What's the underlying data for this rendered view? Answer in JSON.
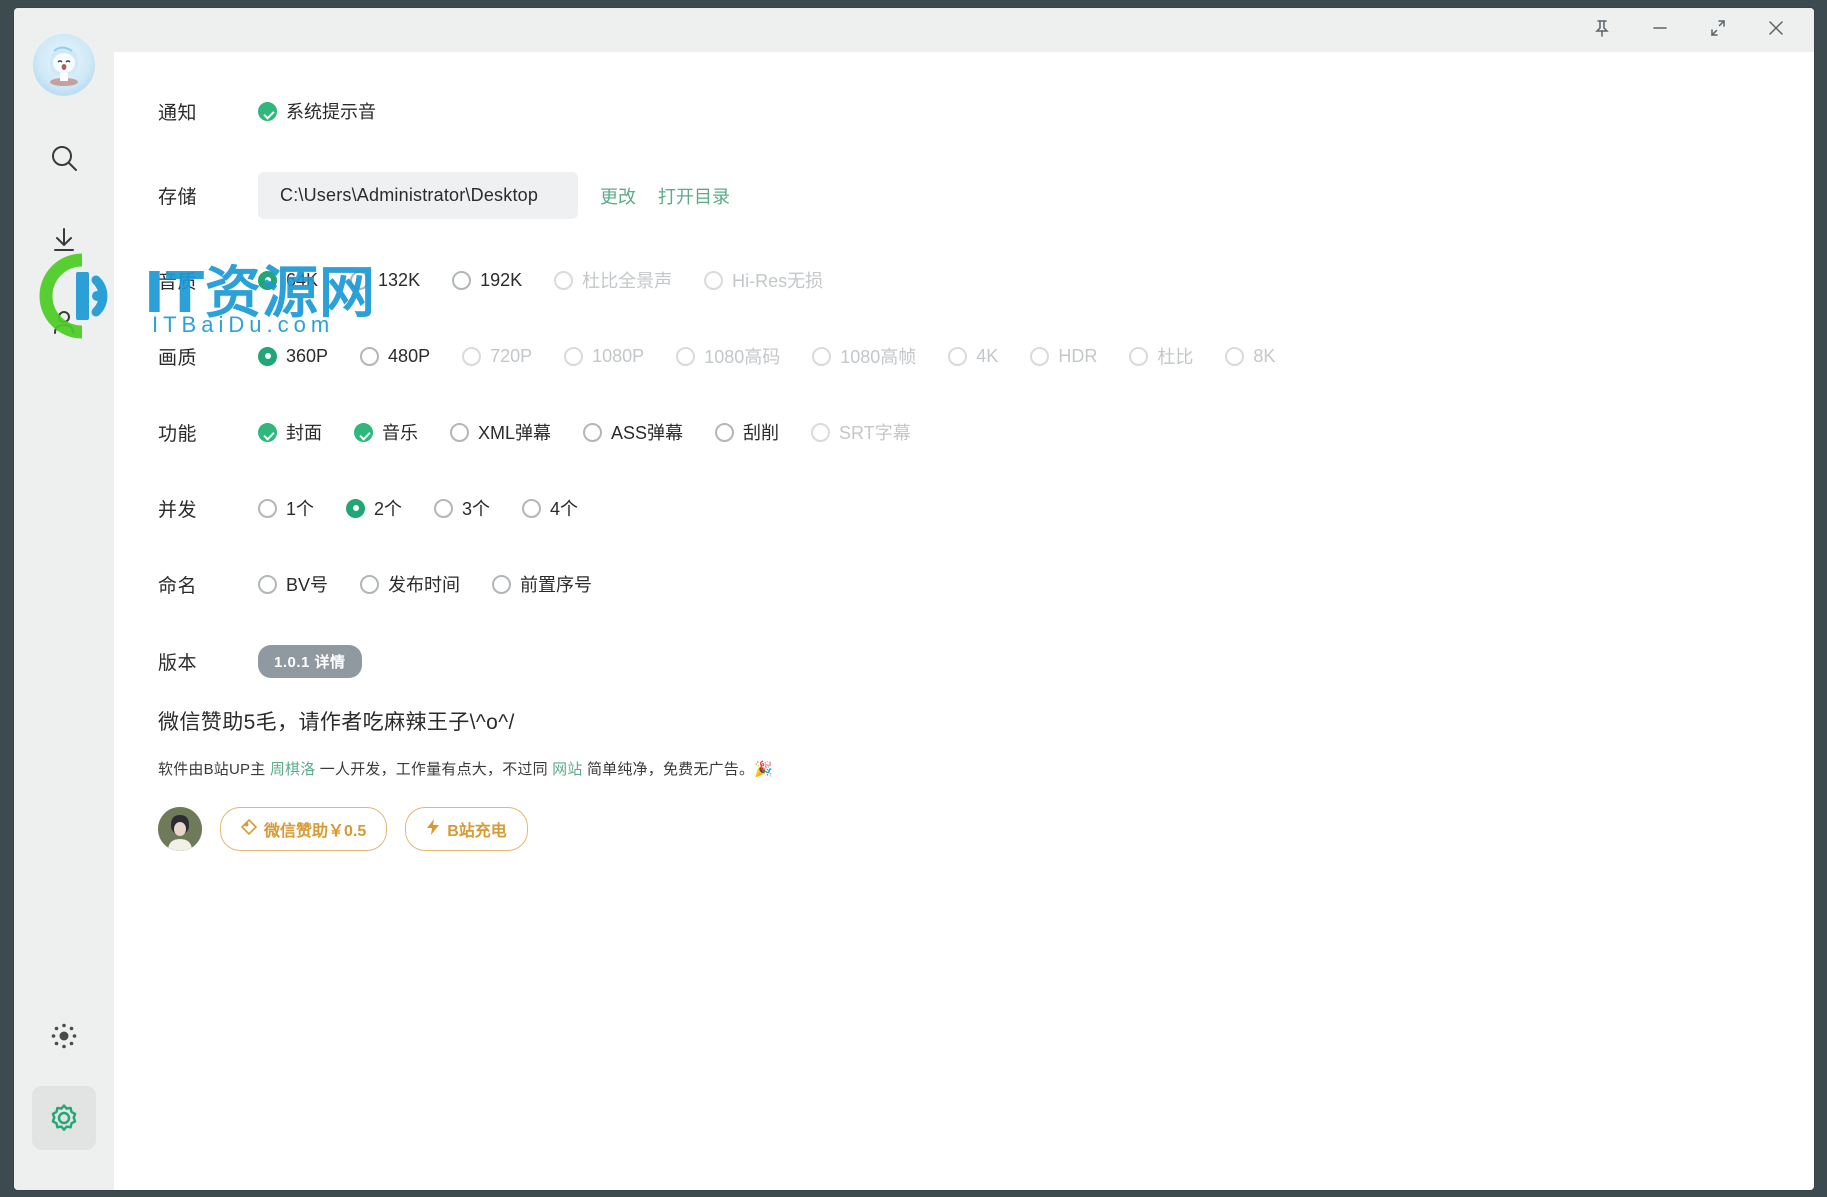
{
  "window": {
    "controls": [
      {
        "name": "pin",
        "label": "Pin"
      },
      {
        "name": "minimize",
        "label": "Minimize"
      },
      {
        "name": "maximize",
        "label": "Maximize"
      },
      {
        "name": "close",
        "label": "Close"
      }
    ]
  },
  "sidebar": {
    "mascot": "mascot-avatar",
    "items": [
      {
        "icon": "search-icon",
        "label": "搜索",
        "active": false
      },
      {
        "icon": "download-icon",
        "label": "下载",
        "active": false
      },
      {
        "icon": "user-icon",
        "label": "用户",
        "active": false
      }
    ],
    "bottom": [
      {
        "icon": "sun-icon",
        "label": "主题",
        "active": false
      },
      {
        "icon": "gear-icon",
        "label": "设置",
        "active": true
      }
    ]
  },
  "accent": {
    "green": "#21a675",
    "check_green": "#2eb87b",
    "link_green": "#5cab8b",
    "orange": "#d79a35",
    "badge_gray": "#9099a0"
  },
  "settings": {
    "notification": {
      "label": "通知",
      "options": [
        {
          "text": "系统提示音",
          "type": "check",
          "checked": true,
          "disabled": false
        }
      ]
    },
    "storage": {
      "label": "存储",
      "path": "C:\\Users\\Administrator\\Desktop",
      "links": [
        "更改",
        "打开目录"
      ]
    },
    "audio": {
      "label": "音质",
      "options": [
        {
          "text": "64K",
          "type": "radio",
          "checked": true,
          "disabled": false
        },
        {
          "text": "132K",
          "type": "radio",
          "checked": false,
          "disabled": false
        },
        {
          "text": "192K",
          "type": "radio",
          "checked": false,
          "disabled": false
        },
        {
          "text": "杜比全景声",
          "type": "radio",
          "checked": false,
          "disabled": true
        },
        {
          "text": "Hi-Res无损",
          "type": "radio",
          "checked": false,
          "disabled": true
        }
      ]
    },
    "quality": {
      "label": "画质",
      "options": [
        {
          "text": "360P",
          "type": "radio",
          "checked": true,
          "disabled": false
        },
        {
          "text": "480P",
          "type": "radio",
          "checked": false,
          "disabled": false
        },
        {
          "text": "720P",
          "type": "radio",
          "checked": false,
          "disabled": true
        },
        {
          "text": "1080P",
          "type": "radio",
          "checked": false,
          "disabled": true
        },
        {
          "text": "1080高码",
          "type": "radio",
          "checked": false,
          "disabled": true
        },
        {
          "text": "1080高帧",
          "type": "radio",
          "checked": false,
          "disabled": true
        },
        {
          "text": "4K",
          "type": "radio",
          "checked": false,
          "disabled": true
        },
        {
          "text": "HDR",
          "type": "radio",
          "checked": false,
          "disabled": true
        },
        {
          "text": "杜比",
          "type": "radio",
          "checked": false,
          "disabled": true
        },
        {
          "text": "8K",
          "type": "radio",
          "checked": false,
          "disabled": true
        }
      ]
    },
    "features": {
      "label": "功能",
      "options": [
        {
          "text": "封面",
          "type": "check",
          "checked": true,
          "disabled": false
        },
        {
          "text": "音乐",
          "type": "check",
          "checked": true,
          "disabled": false
        },
        {
          "text": "XML弹幕",
          "type": "check",
          "checked": false,
          "disabled": false
        },
        {
          "text": "ASS弹幕",
          "type": "check",
          "checked": false,
          "disabled": false
        },
        {
          "text": "刮削",
          "type": "check",
          "checked": false,
          "disabled": false
        },
        {
          "text": "SRT字幕",
          "type": "check",
          "checked": false,
          "disabled": true
        }
      ]
    },
    "concurrency": {
      "label": "并发",
      "options": [
        {
          "text": "1个",
          "type": "radio",
          "checked": false,
          "disabled": false
        },
        {
          "text": "2个",
          "type": "radio",
          "checked": true,
          "disabled": false
        },
        {
          "text": "3个",
          "type": "radio",
          "checked": false,
          "disabled": false
        },
        {
          "text": "4个",
          "type": "radio",
          "checked": false,
          "disabled": false
        }
      ]
    },
    "naming": {
      "label": "命名",
      "options": [
        {
          "text": "BV号",
          "type": "radio",
          "checked": false,
          "disabled": false
        },
        {
          "text": "发布时间",
          "type": "radio",
          "checked": false,
          "disabled": false
        },
        {
          "text": "前置序号",
          "type": "radio",
          "checked": false,
          "disabled": false
        }
      ]
    },
    "version": {
      "label": "版本",
      "badge": "1.0.1 详情"
    }
  },
  "sponsor": {
    "title": "微信赞助5毛，请作者吃麻辣王子\\^o^/",
    "desc_part1": "软件由B站UP主 ",
    "desc_link1": "周棋洛",
    "desc_part2": " 一人开发，工作量有点大，不过同 ",
    "desc_link2": "网站",
    "desc_part3": " 简单纯净，免费无广告。",
    "desc_emoji": "🎉",
    "avatar": "author-avatar",
    "buttons": [
      {
        "icon": "tag-icon",
        "label": "微信赞助￥0.5"
      },
      {
        "icon": "lightning-icon",
        "label": "B站充电"
      }
    ]
  },
  "watermark": {
    "text": "IT资源网",
    "sub": "ITBaiDu.com"
  }
}
